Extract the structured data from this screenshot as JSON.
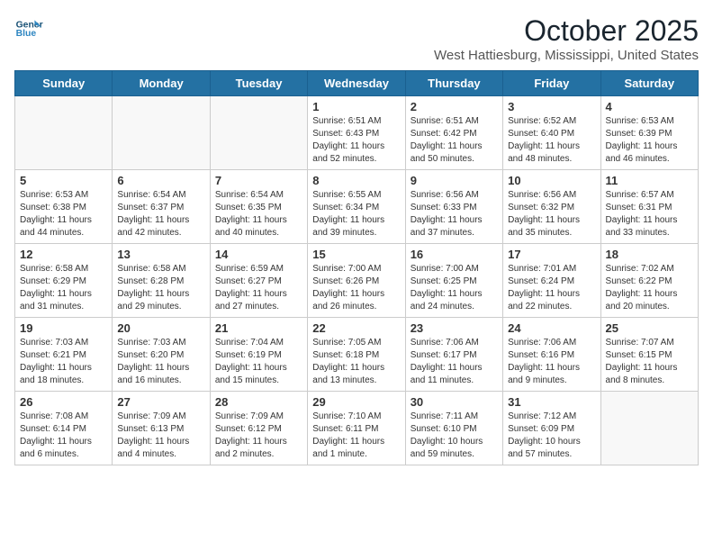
{
  "logo": {
    "line1": "General",
    "line2": "Blue"
  },
  "title": "October 2025",
  "location": "West Hattiesburg, Mississippi, United States",
  "days_of_week": [
    "Sunday",
    "Monday",
    "Tuesday",
    "Wednesday",
    "Thursday",
    "Friday",
    "Saturday"
  ],
  "weeks": [
    [
      {
        "day": "",
        "info": ""
      },
      {
        "day": "",
        "info": ""
      },
      {
        "day": "",
        "info": ""
      },
      {
        "day": "1",
        "info": "Sunrise: 6:51 AM\nSunset: 6:43 PM\nDaylight: 11 hours\nand 52 minutes."
      },
      {
        "day": "2",
        "info": "Sunrise: 6:51 AM\nSunset: 6:42 PM\nDaylight: 11 hours\nand 50 minutes."
      },
      {
        "day": "3",
        "info": "Sunrise: 6:52 AM\nSunset: 6:40 PM\nDaylight: 11 hours\nand 48 minutes."
      },
      {
        "day": "4",
        "info": "Sunrise: 6:53 AM\nSunset: 6:39 PM\nDaylight: 11 hours\nand 46 minutes."
      }
    ],
    [
      {
        "day": "5",
        "info": "Sunrise: 6:53 AM\nSunset: 6:38 PM\nDaylight: 11 hours\nand 44 minutes."
      },
      {
        "day": "6",
        "info": "Sunrise: 6:54 AM\nSunset: 6:37 PM\nDaylight: 11 hours\nand 42 minutes."
      },
      {
        "day": "7",
        "info": "Sunrise: 6:54 AM\nSunset: 6:35 PM\nDaylight: 11 hours\nand 40 minutes."
      },
      {
        "day": "8",
        "info": "Sunrise: 6:55 AM\nSunset: 6:34 PM\nDaylight: 11 hours\nand 39 minutes."
      },
      {
        "day": "9",
        "info": "Sunrise: 6:56 AM\nSunset: 6:33 PM\nDaylight: 11 hours\nand 37 minutes."
      },
      {
        "day": "10",
        "info": "Sunrise: 6:56 AM\nSunset: 6:32 PM\nDaylight: 11 hours\nand 35 minutes."
      },
      {
        "day": "11",
        "info": "Sunrise: 6:57 AM\nSunset: 6:31 PM\nDaylight: 11 hours\nand 33 minutes."
      }
    ],
    [
      {
        "day": "12",
        "info": "Sunrise: 6:58 AM\nSunset: 6:29 PM\nDaylight: 11 hours\nand 31 minutes."
      },
      {
        "day": "13",
        "info": "Sunrise: 6:58 AM\nSunset: 6:28 PM\nDaylight: 11 hours\nand 29 minutes."
      },
      {
        "day": "14",
        "info": "Sunrise: 6:59 AM\nSunset: 6:27 PM\nDaylight: 11 hours\nand 27 minutes."
      },
      {
        "day": "15",
        "info": "Sunrise: 7:00 AM\nSunset: 6:26 PM\nDaylight: 11 hours\nand 26 minutes."
      },
      {
        "day": "16",
        "info": "Sunrise: 7:00 AM\nSunset: 6:25 PM\nDaylight: 11 hours\nand 24 minutes."
      },
      {
        "day": "17",
        "info": "Sunrise: 7:01 AM\nSunset: 6:24 PM\nDaylight: 11 hours\nand 22 minutes."
      },
      {
        "day": "18",
        "info": "Sunrise: 7:02 AM\nSunset: 6:22 PM\nDaylight: 11 hours\nand 20 minutes."
      }
    ],
    [
      {
        "day": "19",
        "info": "Sunrise: 7:03 AM\nSunset: 6:21 PM\nDaylight: 11 hours\nand 18 minutes."
      },
      {
        "day": "20",
        "info": "Sunrise: 7:03 AM\nSunset: 6:20 PM\nDaylight: 11 hours\nand 16 minutes."
      },
      {
        "day": "21",
        "info": "Sunrise: 7:04 AM\nSunset: 6:19 PM\nDaylight: 11 hours\nand 15 minutes."
      },
      {
        "day": "22",
        "info": "Sunrise: 7:05 AM\nSunset: 6:18 PM\nDaylight: 11 hours\nand 13 minutes."
      },
      {
        "day": "23",
        "info": "Sunrise: 7:06 AM\nSunset: 6:17 PM\nDaylight: 11 hours\nand 11 minutes."
      },
      {
        "day": "24",
        "info": "Sunrise: 7:06 AM\nSunset: 6:16 PM\nDaylight: 11 hours\nand 9 minutes."
      },
      {
        "day": "25",
        "info": "Sunrise: 7:07 AM\nSunset: 6:15 PM\nDaylight: 11 hours\nand 8 minutes."
      }
    ],
    [
      {
        "day": "26",
        "info": "Sunrise: 7:08 AM\nSunset: 6:14 PM\nDaylight: 11 hours\nand 6 minutes."
      },
      {
        "day": "27",
        "info": "Sunrise: 7:09 AM\nSunset: 6:13 PM\nDaylight: 11 hours\nand 4 minutes."
      },
      {
        "day": "28",
        "info": "Sunrise: 7:09 AM\nSunset: 6:12 PM\nDaylight: 11 hours\nand 2 minutes."
      },
      {
        "day": "29",
        "info": "Sunrise: 7:10 AM\nSunset: 6:11 PM\nDaylight: 11 hours\nand 1 minute."
      },
      {
        "day": "30",
        "info": "Sunrise: 7:11 AM\nSunset: 6:10 PM\nDaylight: 10 hours\nand 59 minutes."
      },
      {
        "day": "31",
        "info": "Sunrise: 7:12 AM\nSunset: 6:09 PM\nDaylight: 10 hours\nand 57 minutes."
      },
      {
        "day": "",
        "info": ""
      }
    ]
  ]
}
